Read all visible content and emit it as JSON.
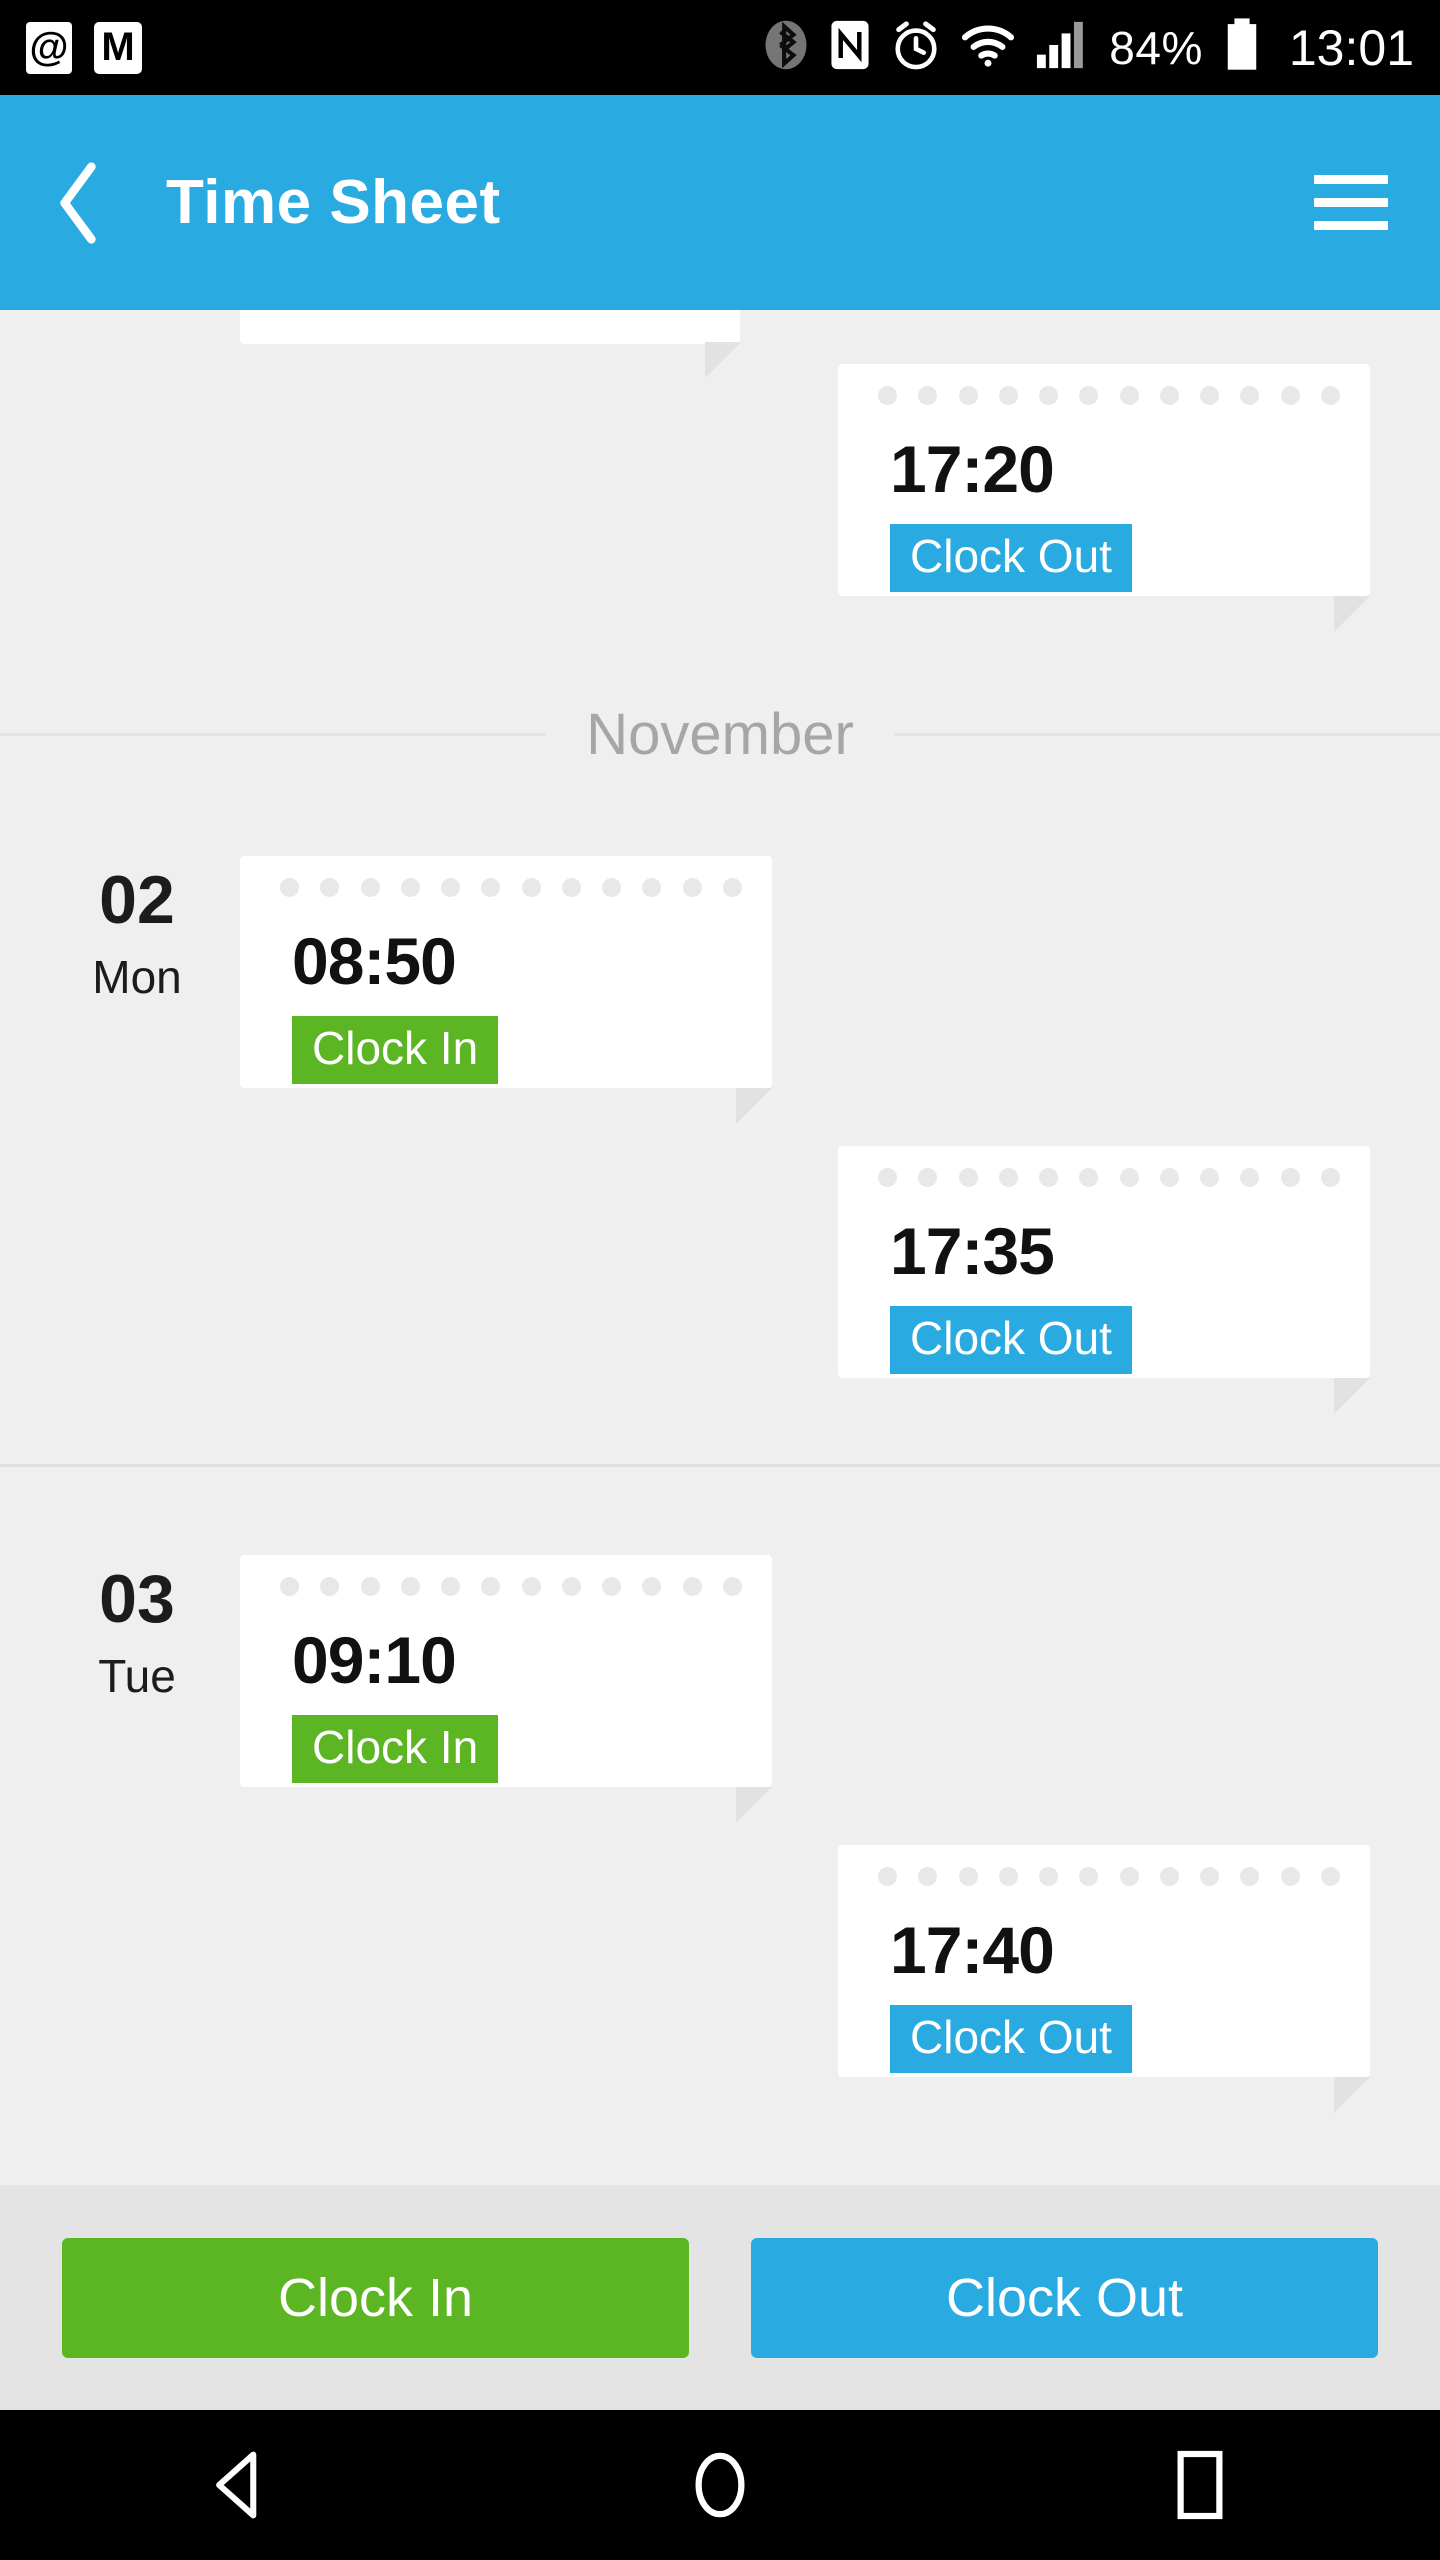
{
  "status_bar": {
    "left_icons": [
      {
        "name": "email-at-icon",
        "glyph": "@"
      },
      {
        "name": "gmail-icon",
        "glyph": "M"
      }
    ],
    "right_icons": [
      {
        "name": "bluetooth-icon"
      },
      {
        "name": "nfc-icon"
      },
      {
        "name": "alarm-clock-icon"
      },
      {
        "name": "wifi-icon"
      },
      {
        "name": "cellular-signal-icon"
      }
    ],
    "battery_percent": "84%",
    "clock": "13:01"
  },
  "app_bar": {
    "back_icon": "back-chevron-icon",
    "title": "Time Sheet",
    "menu_icon": "hamburger-menu-icon"
  },
  "colors": {
    "accent_blue": "#29abe2",
    "accent_green": "#5cb522",
    "page_background": "#efefef",
    "bottom_bar_background": "#e4e4e4"
  },
  "timesheet": {
    "partial_top_entry": {
      "time": "17:20",
      "badge": "Clock Out",
      "type": "out"
    },
    "month_divider": "November",
    "days": [
      {
        "date": "02",
        "weekday": "Mon",
        "punches": [
          {
            "time": "08:50",
            "badge": "Clock In",
            "type": "in"
          },
          {
            "time": "17:35",
            "badge": "Clock Out",
            "type": "out"
          }
        ]
      },
      {
        "date": "03",
        "weekday": "Tue",
        "punches": [
          {
            "time": "09:10",
            "badge": "Clock In",
            "type": "in"
          },
          {
            "time": "17:40",
            "badge": "Clock Out",
            "type": "out"
          }
        ]
      }
    ]
  },
  "bottom_actions": {
    "clock_in_label": "Clock In",
    "clock_out_label": "Clock Out"
  },
  "nav_bar": {
    "back_icon": "android-back-icon",
    "home_icon": "android-home-icon",
    "recents_icon": "android-recents-icon"
  }
}
